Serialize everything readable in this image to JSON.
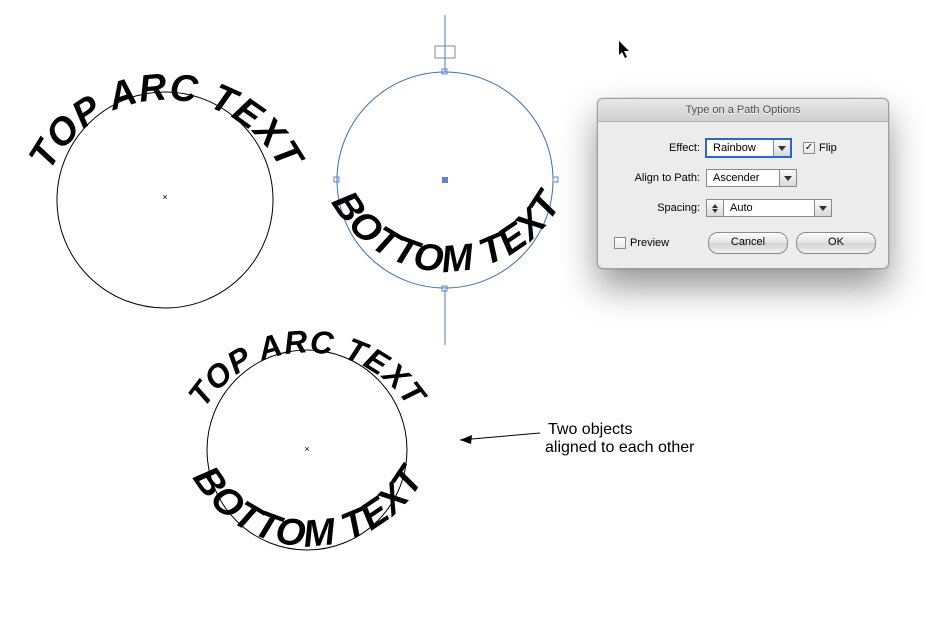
{
  "artwork": {
    "circle1": {
      "top_text": "TOP ARC TEXT"
    },
    "circle2": {
      "bottom_text": "BOTTOM TEXT"
    },
    "circle3": {
      "top_text": "TOP ARC TEXT",
      "bottom_text": "BOTTOM TEXT"
    }
  },
  "annotation": {
    "line1": "Two objects",
    "line2": "aligned to each other"
  },
  "dialog": {
    "title": "Type on a Path Options",
    "effect_label": "Effect:",
    "effect_value": "Rainbow",
    "flip_label": "Flip",
    "flip_checked": true,
    "align_label": "Align to Path:",
    "align_value": "Ascender",
    "spacing_label": "Spacing:",
    "spacing_value": "Auto",
    "preview_label": "Preview",
    "preview_checked": false,
    "cancel_label": "Cancel",
    "ok_label": "OK"
  }
}
